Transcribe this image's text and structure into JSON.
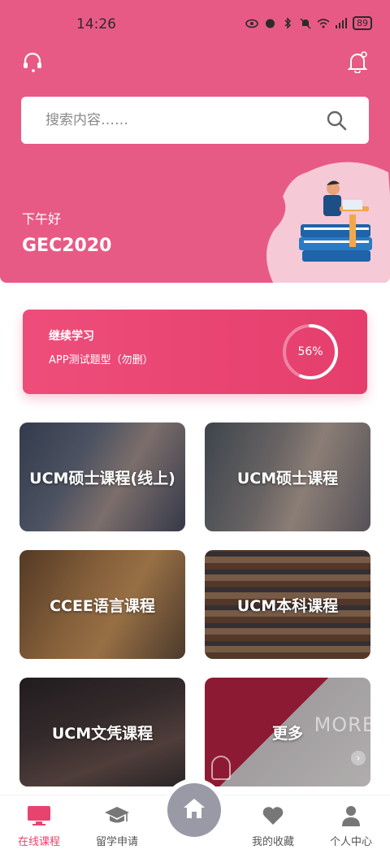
{
  "status_bar": {
    "time": "14:26",
    "battery": "89"
  },
  "header": {
    "search_placeholder": "搜索内容……"
  },
  "greeting": "下午好",
  "username": "GEC2020",
  "continue_card": {
    "title": "继续学习",
    "course": "APP测试题型（勿删）",
    "progress_label": "56%",
    "progress": 0.56
  },
  "courses": [
    {
      "label": "UCM硕士课程(线上)"
    },
    {
      "label": "UCM硕士课程"
    },
    {
      "label": "CCEE语言课程"
    },
    {
      "label": "UCM本科课程"
    },
    {
      "label": "UCM文凭课程"
    },
    {
      "label": "更多",
      "watermark": "MORE"
    }
  ],
  "tabbar": {
    "items": [
      {
        "label": "在线课程",
        "icon": "monitor-icon",
        "active": true
      },
      {
        "label": "留学申请",
        "icon": "graduation-cap-icon"
      },
      {
        "label": "",
        "icon": "home-icon"
      },
      {
        "label": "我的收藏",
        "icon": "heart-icon"
      },
      {
        "label": "个人中心",
        "icon": "person-icon"
      }
    ]
  },
  "colors": {
    "primary": "#e85a86",
    "accent": "#e8436f",
    "home_button": "#9a9aa6"
  }
}
